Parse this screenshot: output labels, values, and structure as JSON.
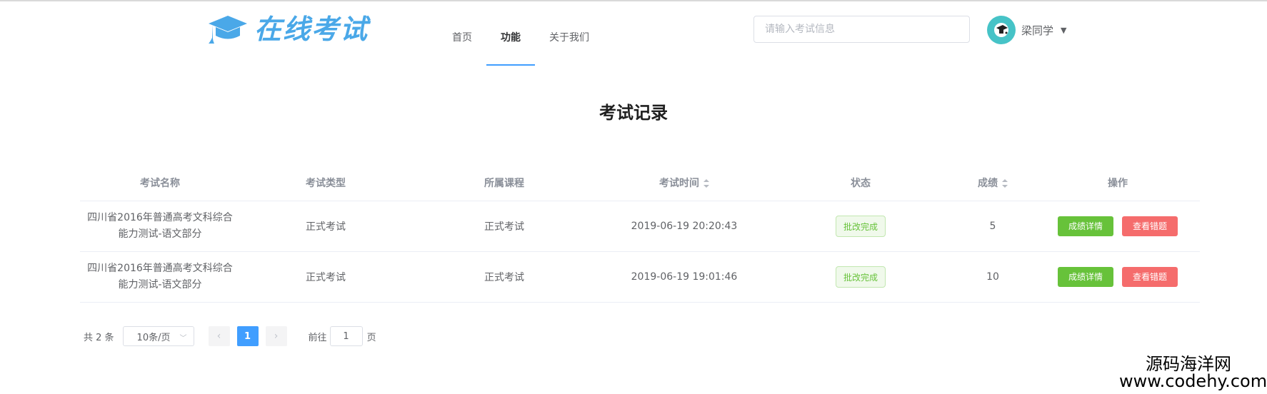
{
  "header": {
    "logo_text": "在线考试",
    "nav": [
      "首页",
      "功能",
      "关于我们"
    ],
    "active_nav_index": 1,
    "search_placeholder": "请输入考试信息",
    "user_name": "梁同学",
    "icons": {
      "logo": "graduation-cap-icon",
      "avatar": "avatar-icon",
      "dropdown": "caret-down-icon"
    }
  },
  "page": {
    "title": "考试记录"
  },
  "table": {
    "headers": [
      "考试名称",
      "考试类型",
      "所属课程",
      "考试时间",
      "状态",
      "成绩",
      "操作"
    ],
    "rows": [
      {
        "name_line1": "四川省2016年普通高考文科综合",
        "name_line2": "能力测试-语文部分",
        "type": "正式考试",
        "course": "正式考试",
        "time": "2019-06-19 20:20:43",
        "status": "批改完成",
        "score": "5",
        "detail_btn": "成绩详情",
        "wrong_btn": "查看错题"
      },
      {
        "name_line1": "四川省2016年普通高考文科综合",
        "name_line2": "能力测试-语文部分",
        "type": "正式考试",
        "course": "正式考试",
        "time": "2019-06-19 19:01:46",
        "status": "批改完成",
        "score": "10",
        "detail_btn": "成绩详情",
        "wrong_btn": "查看错题"
      }
    ]
  },
  "pagination": {
    "total": "共 2 条",
    "page_size": "10条/页",
    "current_page": "1",
    "goto_label": "前往",
    "goto_value": "1",
    "page_suffix": "页"
  },
  "watermark": {
    "line1": "源码海洋网",
    "line2": "www.codehy.com"
  },
  "colors": {
    "primary": "#409eff",
    "success": "#67c23a",
    "danger": "#f56c6c",
    "logo": "#4aa8e8",
    "avatar_bg": "#46c3c7"
  }
}
